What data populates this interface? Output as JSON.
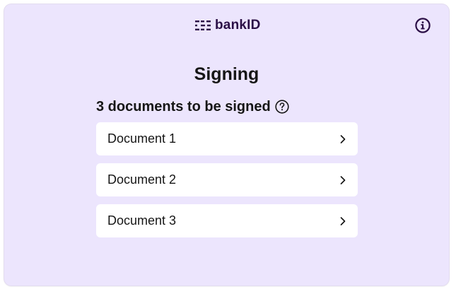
{
  "header": {
    "brand": "bankID",
    "info_icon": "info-icon"
  },
  "main": {
    "title": "Signing",
    "subtitle": "3 documents to be signed",
    "help_icon": "question-circle-icon",
    "documents": [
      {
        "label": "Document 1",
        "icon": "chevron-right-icon"
      },
      {
        "label": "Document 2",
        "icon": "chevron-right-icon"
      },
      {
        "label": "Document 3",
        "icon": "chevron-right-icon"
      }
    ]
  },
  "colors": {
    "card_background": "#ece5fd",
    "brand": "#2b0f46",
    "text": "#161616",
    "item_background": "#ffffff"
  }
}
